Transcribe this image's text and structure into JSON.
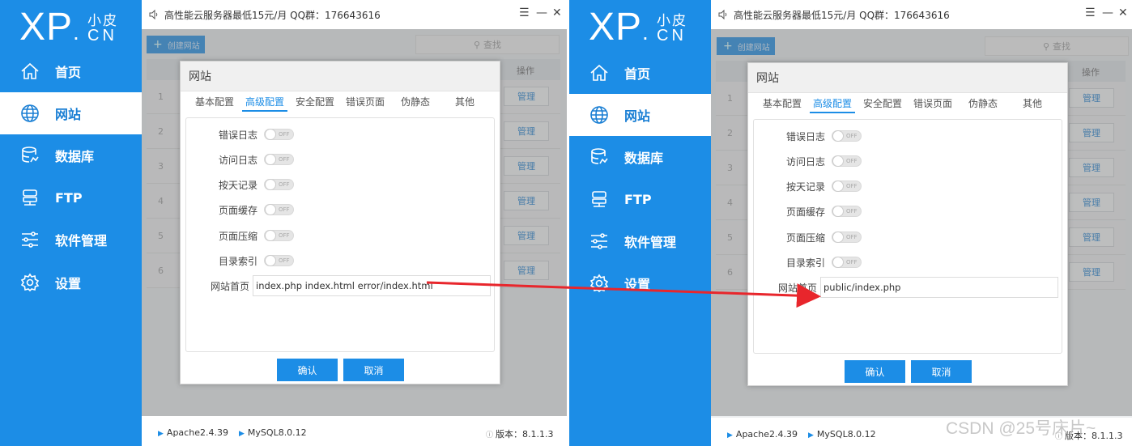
{
  "logo": {
    "xp": "XP",
    "dot": ".",
    "cn_top": "小皮",
    "cn_bottom": "CN"
  },
  "sidebar": {
    "items": [
      {
        "label": "首页",
        "icon": "home-icon"
      },
      {
        "label": "网站",
        "icon": "globe-icon",
        "active": true
      },
      {
        "label": "数据库",
        "icon": "database-icon"
      },
      {
        "label": "FTP",
        "icon": "server-icon"
      },
      {
        "label": "软件管理",
        "icon": "sliders-icon"
      },
      {
        "label": "设置",
        "icon": "gear-icon"
      }
    ]
  },
  "titlebar": {
    "text": "高性能云服务器最低15元/月  QQ群：176643616",
    "menu": "☰",
    "minimize": "—",
    "close": "✕"
  },
  "toolbar": {
    "create_label": "创建网站",
    "search_label": "查找"
  },
  "table": {
    "operation_header": "操作",
    "rows": [
      {
        "num": "1",
        "action": "管理"
      },
      {
        "num": "2",
        "action": "管理"
      },
      {
        "num": "3",
        "action": "管理"
      },
      {
        "num": "4",
        "action": "管理"
      },
      {
        "num": "5",
        "action": "管理"
      },
      {
        "num": "6",
        "action": "管理"
      }
    ]
  },
  "dialog": {
    "title": "网站",
    "tabs": [
      "基本配置",
      "高级配置",
      "安全配置",
      "错误页面",
      "伪静态",
      "其他"
    ],
    "active_tab": "高级配置",
    "settings": [
      {
        "label": "错误日志",
        "state": "OFF"
      },
      {
        "label": "访问日志",
        "state": "OFF"
      },
      {
        "label": "按天记录",
        "state": "OFF"
      },
      {
        "label": "页面缓存",
        "state": "OFF"
      },
      {
        "label": "页面压缩",
        "state": "OFF"
      },
      {
        "label": "目录索引",
        "state": "OFF"
      }
    ],
    "homepage_label": "网站首页",
    "confirm_label": "确认",
    "cancel_label": "取消"
  },
  "left_panel": {
    "homepage_value": "index.php index.html error/index.html"
  },
  "right_panel": {
    "homepage_value": "public/index.php"
  },
  "footer": {
    "apache": "Apache2.4.39",
    "mysql": "MySQL8.0.12",
    "version": "版本：8.1.1.3",
    "version_icon": "info-icon"
  },
  "watermark": "CSDN @25号床片~",
  "colors": {
    "brand": "#1c8de6",
    "arrow": "#e8262c"
  }
}
